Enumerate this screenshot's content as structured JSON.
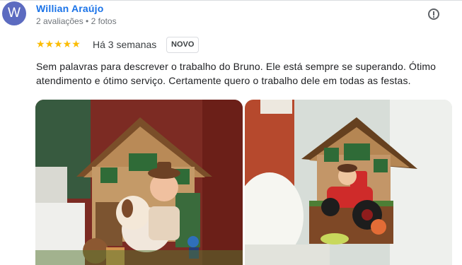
{
  "review": {
    "avatar_letter": "W",
    "author_name": "Willian Araújo",
    "author_meta": "2 avaliações • 2 fotos",
    "stars": "★★★★★",
    "rating": 5,
    "date": "Há 3 semanas",
    "badge": "NOVO",
    "text": "Sem palavras para descrever o trabalho do Bruno. Ele está sempre se superando. Ótimo atendimento e ótimo serviço. Certamente quero o trabalho dele em todas as festas."
  },
  "icons": {
    "report": "flag-icon"
  },
  "colors": {
    "avatar_bg": "#5c6bc0",
    "name": "#1a73e8",
    "stars": "#fbbc04"
  }
}
